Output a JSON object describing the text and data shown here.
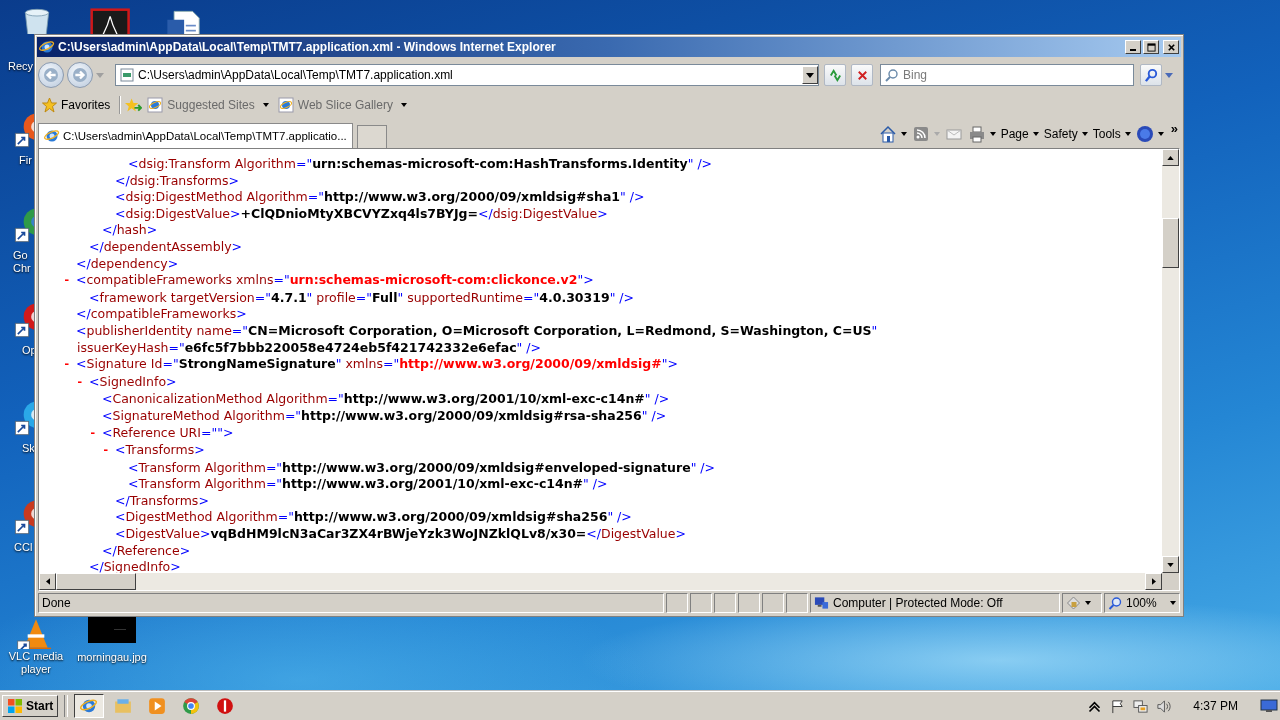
{
  "desktop": {
    "icons": [
      {
        "kind": "recycle-bin",
        "label": "Recy"
      },
      {
        "kind": "pdf"
      },
      {
        "kind": "word"
      },
      {
        "kind": "firefox",
        "label": "Fir"
      },
      {
        "kind": "chrome",
        "label": "Go Chr"
      },
      {
        "kind": "opera",
        "label": "Op"
      },
      {
        "kind": "skype",
        "label": "Sk"
      },
      {
        "kind": "ccleaner",
        "label": "CCl"
      },
      {
        "kind": "vlc",
        "label": "VLC media player"
      },
      {
        "kind": "image",
        "label": "morningau.jpg"
      }
    ]
  },
  "window": {
    "title": "C:\\Users\\admin\\AppData\\Local\\Temp\\TMT7.application.xml - Windows Internet Explorer",
    "address": "C:\\Users\\admin\\AppData\\Local\\Temp\\TMT7.application.xml",
    "search_placeholder": "Bing",
    "favorites_bar": [
      {
        "kind": "favorites",
        "label": "Favorites"
      },
      {
        "kind": "add"
      },
      {
        "kind": "link",
        "label": "Suggested Sites"
      },
      {
        "kind": "link",
        "label": "Web Slice Gallery"
      }
    ],
    "tabs": [
      {
        "label": "C:\\Users\\admin\\AppData\\Local\\Temp\\TMT7.applicatio...",
        "selected": true
      }
    ],
    "command_bar": [
      {
        "kind": "home"
      },
      {
        "kind": "feeds"
      },
      {
        "kind": "mail"
      },
      {
        "kind": "print"
      },
      {
        "kind": "menu",
        "label": "Page"
      },
      {
        "kind": "menu",
        "label": "Safety"
      },
      {
        "kind": "menu",
        "label": "Tools"
      },
      {
        "kind": "help"
      }
    ],
    "overflow": "»",
    "xml": [
      {
        "children": [
          {
            "children": [
              {
                "children": [
                  {
                    "children": [
                      {
                        "segments": [
                          {
                            "kind": "punct",
                            "text": "<"
                          },
                          {
                            "kind": "tag",
                            "text": "dsig:Transform"
                          },
                          {
                            "kind": "attr",
                            "text": " Algorithm"
                          },
                          {
                            "kind": "punct",
                            "text": "=\""
                          },
                          {
                            "kind": "value",
                            "text": "urn:schemas-microsoft-com:HashTransforms.Identity"
                          },
                          {
                            "kind": "punct",
                            "text": "\" />"
                          }
                        ]
                      }
                    ]
                  },
                  {
                    "segments": [
                      {
                        "kind": "punct",
                        "text": "</"
                      },
                      {
                        "kind": "tag",
                        "text": "dsig:Transforms"
                      },
                      {
                        "kind": "punct",
                        "text": ">"
                      }
                    ]
                  },
                  {
                    "segments": [
                      {
                        "kind": "punct",
                        "text": "<"
                      },
                      {
                        "kind": "tag",
                        "text": "dsig:DigestMethod"
                      },
                      {
                        "kind": "attr",
                        "text": " Algorithm"
                      },
                      {
                        "kind": "punct",
                        "text": "=\""
                      },
                      {
                        "kind": "value",
                        "text": "http://www.w3.org/2000/09/xmldsig#sha1"
                      },
                      {
                        "kind": "punct",
                        "text": "\" />"
                      }
                    ]
                  },
                  {
                    "segments": [
                      {
                        "kind": "punct",
                        "text": "<"
                      },
                      {
                        "kind": "tag",
                        "text": "dsig:DigestValue"
                      },
                      {
                        "kind": "punct",
                        "text": ">"
                      },
                      {
                        "kind": "value",
                        "text": "+ClQDnioMtyXBCVYZxq4ls7BYJg="
                      },
                      {
                        "kind": "punct",
                        "text": "</"
                      },
                      {
                        "kind": "tag",
                        "text": "dsig:DigestValue"
                      },
                      {
                        "kind": "punct",
                        "text": ">"
                      }
                    ]
                  }
                ]
              },
              {
                "segments": [
                  {
                    "kind": "punct",
                    "text": "</"
                  },
                  {
                    "kind": "tag",
                    "text": "hash"
                  },
                  {
                    "kind": "punct",
                    "text": ">"
                  }
                ]
              }
            ]
          },
          {
            "segments": [
              {
                "kind": "punct",
                "text": "</"
              },
              {
                "kind": "tag",
                "text": "dependentAssembly"
              },
              {
                "kind": "punct",
                "text": ">"
              }
            ]
          }
        ]
      },
      {
        "segments": [
          {
            "kind": "punct",
            "text": "</"
          },
          {
            "kind": "tag",
            "text": "dependency"
          },
          {
            "kind": "punct",
            "text": ">"
          }
        ]
      },
      {
        "toggle": "-",
        "segments": [
          {
            "kind": "punct",
            "text": "<"
          },
          {
            "kind": "tag",
            "text": "compatibleFrameworks"
          },
          {
            "kind": "attr",
            "text": " xmlns"
          },
          {
            "kind": "punct",
            "text": "=\""
          },
          {
            "kind": "ns",
            "text": "urn:schemas-microsoft-com:clickonce.v2"
          },
          {
            "kind": "punct",
            "text": "\">"
          }
        ],
        "children": [
          {
            "segments": [
              {
                "kind": "punct",
                "text": "<"
              },
              {
                "kind": "tag",
                "text": "framework"
              },
              {
                "kind": "attr",
                "text": " targetVersion"
              },
              {
                "kind": "punct",
                "text": "=\""
              },
              {
                "kind": "value",
                "text": "4.7.1"
              },
              {
                "kind": "punct",
                "text": "\""
              },
              {
                "kind": "attr",
                "text": " profile"
              },
              {
                "kind": "punct",
                "text": "=\""
              },
              {
                "kind": "value",
                "text": "Full"
              },
              {
                "kind": "punct",
                "text": "\""
              },
              {
                "kind": "attr",
                "text": " supportedRuntime"
              },
              {
                "kind": "punct",
                "text": "=\""
              },
              {
                "kind": "value",
                "text": "4.0.30319"
              },
              {
                "kind": "punct",
                "text": "\" />"
              }
            ]
          }
        ]
      },
      {
        "segments": [
          {
            "kind": "punct",
            "text": "</"
          },
          {
            "kind": "tag",
            "text": "compatibleFrameworks"
          },
          {
            "kind": "punct",
            "text": ">"
          }
        ]
      },
      {
        "segments": [
          {
            "kind": "punct",
            "text": "<"
          },
          {
            "kind": "tag",
            "text": "publisherIdentity"
          },
          {
            "kind": "attr",
            "text": " name"
          },
          {
            "kind": "punct",
            "text": "=\""
          },
          {
            "kind": "value",
            "text": "CN=Microsoft Corporation, O=Microsoft Corporation, L=Redmond, S=Washington, C=US"
          },
          {
            "kind": "punct",
            "text": "\""
          }
        ],
        "continuation": [
          {
            "kind": "attr",
            "text": "issuerKeyHash"
          },
          {
            "kind": "punct",
            "text": "=\""
          },
          {
            "kind": "value",
            "text": "e6fc5f7bbb220058e4724eb5f421742332e6efac"
          },
          {
            "kind": "punct",
            "text": "\" />"
          }
        ]
      },
      {
        "toggle": "-",
        "segments": [
          {
            "kind": "punct",
            "text": "<"
          },
          {
            "kind": "tag",
            "text": "Signature"
          },
          {
            "kind": "attr",
            "text": " Id"
          },
          {
            "kind": "punct",
            "text": "=\""
          },
          {
            "kind": "value",
            "text": "StrongNameSignature"
          },
          {
            "kind": "punct",
            "text": "\""
          },
          {
            "kind": "attr",
            "text": " xmlns"
          },
          {
            "kind": "punct",
            "text": "=\""
          },
          {
            "kind": "ns",
            "text": "http://www.w3.org/2000/09/xmldsig#"
          },
          {
            "kind": "punct",
            "text": "\">"
          }
        ],
        "children": [
          {
            "toggle": "-",
            "segments": [
              {
                "kind": "punct",
                "text": "<"
              },
              {
                "kind": "tag",
                "text": "SignedInfo"
              },
              {
                "kind": "punct",
                "text": ">"
              }
            ],
            "children": [
              {
                "segments": [
                  {
                    "kind": "punct",
                    "text": "<"
                  },
                  {
                    "kind": "tag",
                    "text": "CanonicalizationMethod"
                  },
                  {
                    "kind": "attr",
                    "text": " Algorithm"
                  },
                  {
                    "kind": "punct",
                    "text": "=\""
                  },
                  {
                    "kind": "value",
                    "text": "http://www.w3.org/2001/10/xml-exc-c14n#"
                  },
                  {
                    "kind": "punct",
                    "text": "\" />"
                  }
                ]
              },
              {
                "segments": [
                  {
                    "kind": "punct",
                    "text": "<"
                  },
                  {
                    "kind": "tag",
                    "text": "SignatureMethod"
                  },
                  {
                    "kind": "attr",
                    "text": " Algorithm"
                  },
                  {
                    "kind": "punct",
                    "text": "=\""
                  },
                  {
                    "kind": "value",
                    "text": "http://www.w3.org/2000/09/xmldsig#rsa-sha256"
                  },
                  {
                    "kind": "punct",
                    "text": "\" />"
                  }
                ]
              },
              {
                "toggle": "-",
                "segments": [
                  {
                    "kind": "punct",
                    "text": "<"
                  },
                  {
                    "kind": "tag",
                    "text": "Reference"
                  },
                  {
                    "kind": "attr",
                    "text": " URI"
                  },
                  {
                    "kind": "punct",
                    "text": "=\"\">"
                  }
                ],
                "children": [
                  {
                    "toggle": "-",
                    "segments": [
                      {
                        "kind": "punct",
                        "text": "<"
                      },
                      {
                        "kind": "tag",
                        "text": "Transforms"
                      },
                      {
                        "kind": "punct",
                        "text": ">"
                      }
                    ],
                    "children": [
                      {
                        "segments": [
                          {
                            "kind": "punct",
                            "text": "<"
                          },
                          {
                            "kind": "tag",
                            "text": "Transform"
                          },
                          {
                            "kind": "attr",
                            "text": " Algorithm"
                          },
                          {
                            "kind": "punct",
                            "text": "=\""
                          },
                          {
                            "kind": "value",
                            "text": "http://www.w3.org/2000/09/xmldsig#enveloped-signature"
                          },
                          {
                            "kind": "punct",
                            "text": "\" />"
                          }
                        ]
                      },
                      {
                        "segments": [
                          {
                            "kind": "punct",
                            "text": "<"
                          },
                          {
                            "kind": "tag",
                            "text": "Transform"
                          },
                          {
                            "kind": "attr",
                            "text": " Algorithm"
                          },
                          {
                            "kind": "punct",
                            "text": "=\""
                          },
                          {
                            "kind": "value",
                            "text": "http://www.w3.org/2001/10/xml-exc-c14n#"
                          },
                          {
                            "kind": "punct",
                            "text": "\" />"
                          }
                        ]
                      }
                    ]
                  },
                  {
                    "segments": [
                      {
                        "kind": "punct",
                        "text": "</"
                      },
                      {
                        "kind": "tag",
                        "text": "Transforms"
                      },
                      {
                        "kind": "punct",
                        "text": ">"
                      }
                    ]
                  },
                  {
                    "segments": [
                      {
                        "kind": "punct",
                        "text": "<"
                      },
                      {
                        "kind": "tag",
                        "text": "DigestMethod"
                      },
                      {
                        "kind": "attr",
                        "text": " Algorithm"
                      },
                      {
                        "kind": "punct",
                        "text": "=\""
                      },
                      {
                        "kind": "value",
                        "text": "http://www.w3.org/2000/09/xmldsig#sha256"
                      },
                      {
                        "kind": "punct",
                        "text": "\" />"
                      }
                    ]
                  },
                  {
                    "segments": [
                      {
                        "kind": "punct",
                        "text": "<"
                      },
                      {
                        "kind": "tag",
                        "text": "DigestValue"
                      },
                      {
                        "kind": "punct",
                        "text": ">"
                      },
                      {
                        "kind": "value",
                        "text": "vqBdHM9lcN3aCar3ZX4rBWjeYzk3WoJNZklQLv8/x30="
                      },
                      {
                        "kind": "punct",
                        "text": "</"
                      },
                      {
                        "kind": "tag",
                        "text": "DigestValue"
                      },
                      {
                        "kind": "punct",
                        "text": ">"
                      }
                    ]
                  }
                ]
              },
              {
                "segments": [
                  {
                    "kind": "punct",
                    "text": "</"
                  },
                  {
                    "kind": "tag",
                    "text": "Reference"
                  },
                  {
                    "kind": "punct",
                    "text": ">"
                  }
                ]
              }
            ]
          },
          {
            "segments": [
              {
                "kind": "punct",
                "text": "</"
              },
              {
                "kind": "tag",
                "text": "SignedInfo"
              },
              {
                "kind": "punct",
                "text": ">"
              }
            ]
          }
        ]
      }
    ],
    "status_bar": {
      "text": "Done",
      "zone": "Computer | Protected Mode: Off",
      "zoom": "100%"
    }
  },
  "taskbar": {
    "start": "Start",
    "items": [
      {
        "kind": "ie",
        "selected": true
      },
      {
        "kind": "explorer",
        "selected": false
      },
      {
        "kind": "media-player",
        "selected": false
      },
      {
        "kind": "chrome",
        "selected": false
      },
      {
        "kind": "stop-app",
        "selected": false
      }
    ],
    "tray": [
      {
        "kind": "arrow"
      },
      {
        "kind": "flag"
      },
      {
        "kind": "network"
      },
      {
        "kind": "volume"
      }
    ],
    "clock": "4:37 PM"
  }
}
